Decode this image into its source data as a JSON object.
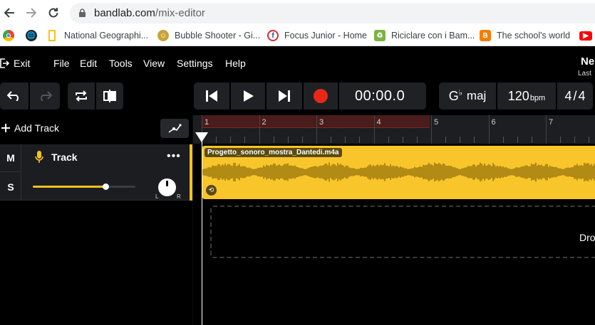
{
  "browser": {
    "url_domain": "bandlab.com",
    "url_path": "/mix-editor"
  },
  "bookmarks": [
    {
      "label": "",
      "icon": "chrome-icon"
    },
    {
      "label": "",
      "icon": "globe-icon"
    },
    {
      "label": "National Geographi...",
      "icon": "natgeo-icon"
    },
    {
      "label": "Bubble Shooter - Gi...",
      "icon": "bubble-icon"
    },
    {
      "label": "Focus Junior - Home",
      "icon": "focus-icon"
    },
    {
      "label": "Riciclare con i Bam...",
      "icon": "recycle-icon"
    },
    {
      "label": "The school's world",
      "icon": "blogger-icon"
    },
    {
      "label": "",
      "icon": "youtube-icon"
    }
  ],
  "menu": {
    "exit": "Exit",
    "file": "File",
    "edit": "Edit",
    "tools": "Tools",
    "view": "View",
    "settings": "Settings",
    "help": "Help"
  },
  "project": {
    "title": "Ne",
    "subtitle": "Last"
  },
  "transport": {
    "time": "00:00.0",
    "key_root": "G",
    "key_accidental": "♭",
    "key_mode": "maj",
    "tempo": "120",
    "tempo_unit": "bpm",
    "time_sig_num": "4",
    "time_sig_den": "4"
  },
  "tracks_panel": {
    "add_track": "Add Track"
  },
  "track": {
    "mute": "M",
    "solo": "S",
    "name": "Track",
    "more": "•••",
    "pan_left": "L",
    "pan_right": "R",
    "volume_level": 0.71
  },
  "ruler": {
    "bars": [
      "1",
      "2",
      "3",
      "4",
      "5",
      "6",
      "7"
    ]
  },
  "clip": {
    "name": "Progetto_sonoro_mostra_Dantedi.m4a",
    "color": "#f8c52b"
  },
  "drop_zone": {
    "text": "Dro"
  },
  "colors": {
    "accent": "#f5c21b",
    "record": "#e8271b",
    "loop_region": "#4a1c1c"
  }
}
